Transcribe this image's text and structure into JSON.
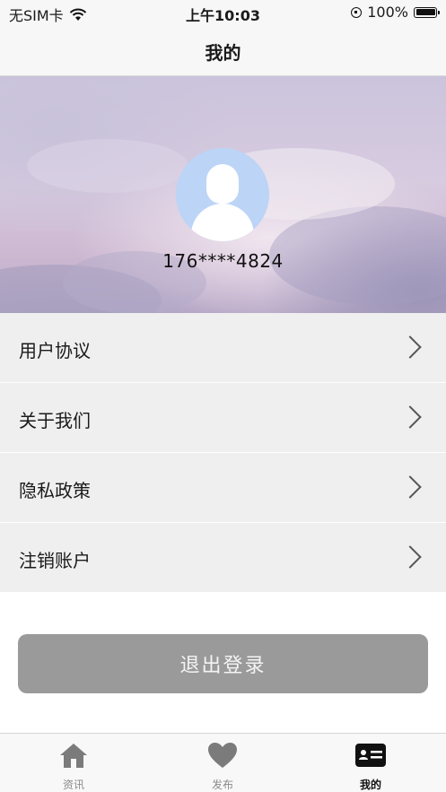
{
  "status_bar": {
    "carrier": "无SIM卡",
    "time": "上午10:03",
    "battery": "100%",
    "icons": [
      "wifi-icon",
      "rotation-lock-icon",
      "battery-icon"
    ]
  },
  "nav": {
    "title": "我的"
  },
  "profile": {
    "phone": "176****4824"
  },
  "menu": {
    "items": [
      {
        "label": "用户协议"
      },
      {
        "label": "关于我们"
      },
      {
        "label": "隐私政策"
      },
      {
        "label": "注销账户"
      }
    ]
  },
  "logout": {
    "label": "退出登录"
  },
  "tabs": [
    {
      "label": "资讯",
      "icon": "home-icon",
      "active": false
    },
    {
      "label": "发布",
      "icon": "heart-icon",
      "active": false
    },
    {
      "label": "我的",
      "icon": "profile-card-icon",
      "active": true
    }
  ],
  "colors": {
    "menu_bg": "#efefef",
    "logout_bg": "#9a9a9a",
    "avatar_bg": "#bcd4f6",
    "tab_inactive": "#8a8a8a",
    "tab_active": "#111111"
  }
}
